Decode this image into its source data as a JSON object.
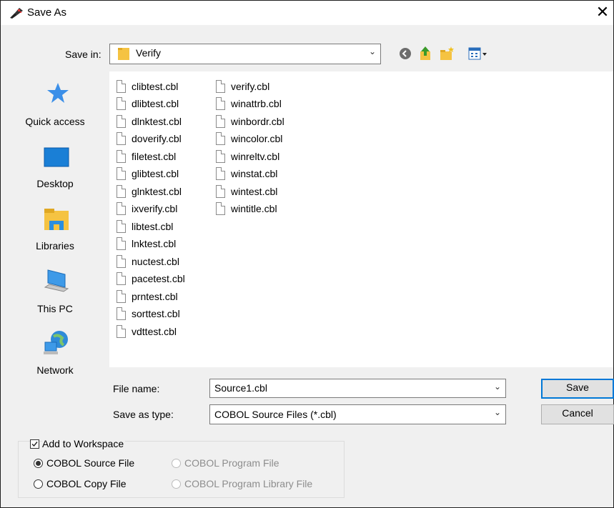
{
  "window": {
    "title": "Save As",
    "close_glyph": "✕"
  },
  "toolbar": {
    "save_in_label": "Save in:",
    "save_in_value": "Verify",
    "back_icon": "back-icon",
    "up_icon": "up-folder-icon",
    "new_folder_icon": "new-folder-icon",
    "view_menu_icon": "view-menu-icon"
  },
  "places": [
    {
      "label": "Quick access",
      "icon": "quick-access-icon"
    },
    {
      "label": "Desktop",
      "icon": "desktop-icon"
    },
    {
      "label": "Libraries",
      "icon": "libraries-icon"
    },
    {
      "label": "This PC",
      "icon": "this-pc-icon"
    },
    {
      "label": "Network",
      "icon": "network-icon"
    }
  ],
  "files": {
    "column1": [
      "clibtest.cbl",
      "dlibtest.cbl",
      "dlnktest.cbl",
      "doverify.cbl",
      "filetest.cbl",
      "glibtest.cbl",
      "glnktest.cbl",
      "ixverify.cbl",
      "libtest.cbl",
      "lnktest.cbl",
      "nuctest.cbl",
      "pacetest.cbl",
      "prntest.cbl",
      "sorttest.cbl",
      "vdttest.cbl"
    ],
    "column2": [
      "verify.cbl",
      "winattrb.cbl",
      "winbordr.cbl",
      "wincolor.cbl",
      "winreltv.cbl",
      "winstat.cbl",
      "wintest.cbl",
      "wintitle.cbl"
    ]
  },
  "form": {
    "file_name_label": "File name:",
    "file_name_value": "Source1.cbl",
    "save_as_type_label": "Save as type:",
    "save_as_type_value": "COBOL Source Files (*.cbl)"
  },
  "buttons": {
    "save": "Save",
    "cancel": "Cancel"
  },
  "options": {
    "add_to_workspace": "Add to Workspace",
    "add_to_workspace_checked": true,
    "cobol_source_file": "COBOL Source File",
    "cobol_copy_file": "COBOL Copy File",
    "cobol_program_file": "COBOL Program File",
    "cobol_program_library_file": "COBOL Program Library File",
    "selected": "COBOL Source File"
  },
  "colors": {
    "accent": "#0078d7",
    "folder": "#f5c342",
    "disabled_text": "#8d8d8d"
  }
}
